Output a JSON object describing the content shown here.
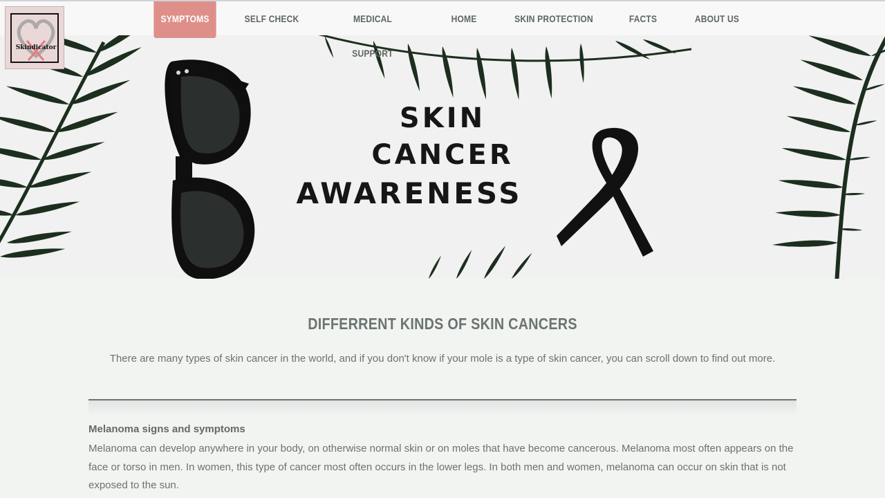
{
  "logo": {
    "text": "Skindicator"
  },
  "nav": {
    "items": [
      {
        "label": "SYMPTOMS",
        "active": true
      },
      {
        "label": "SELF CHECK",
        "active": false
      },
      {
        "label": "MEDICAL SUPPORT",
        "active": false
      },
      {
        "label": "HOME",
        "active": false
      },
      {
        "label": "SKIN PROTECTION",
        "active": false
      },
      {
        "label": "FACTS",
        "active": false
      },
      {
        "label": "ABOUT US",
        "active": false
      }
    ]
  },
  "hero": {
    "lines": [
      "SKIN",
      "CANCER",
      "AWARENESS"
    ]
  },
  "content": {
    "title": "DIFFERRENT KINDS OF SKIN CANCERS",
    "intro": "There are many types of skin cancer in the world, and if you don't know if your mole is a type of skin cancer, you can scroll down to find out more.",
    "section": {
      "heading": "Melanoma signs and symptoms",
      "body": "Melanoma can develop anywhere in your body, on otherwise normal skin or on moles that have become cancerous. Melanoma most often appears on the face or torso in men. In women, this type of cancer most often occurs in the lower legs. In both men and women, melanoma can occur on skin that is not exposed to the sun."
    }
  },
  "colors": {
    "accent": "#df8f8a",
    "nav_text": "#5e6664",
    "heading": "#6b7471",
    "body_text": "#6a7270",
    "background": "#f2f4f2"
  }
}
